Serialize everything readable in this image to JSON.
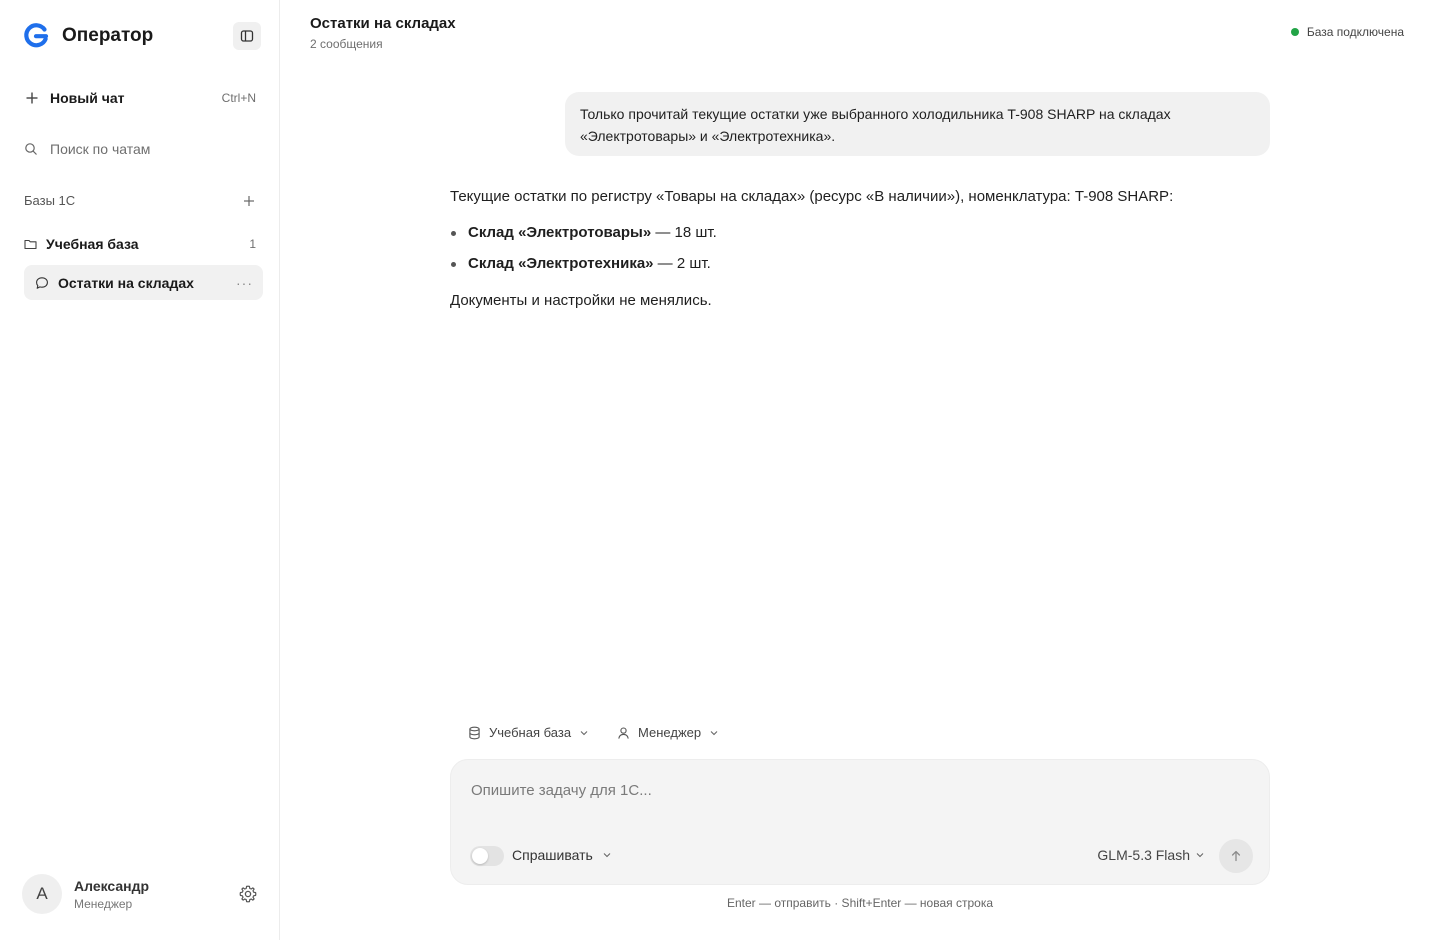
{
  "app": {
    "name": "Оператор"
  },
  "sidebar": {
    "new_chat_label": "Новый чат",
    "new_chat_shortcut": "Ctrl+N",
    "search_placeholder": "Поиск по чатам",
    "section_title": "Базы 1С",
    "folders": [
      {
        "label": "Учебная база",
        "count": "1"
      }
    ],
    "chats": [
      {
        "label": "Остатки на складах",
        "active": true
      }
    ],
    "user": {
      "initial": "A",
      "name": "Александр",
      "role": "Менеджер"
    }
  },
  "header": {
    "title": "Остатки на складах",
    "subtitle": "2 сообщения",
    "status_label": "База подключена",
    "status_color": "#22a447"
  },
  "messages": {
    "user": "Только прочитай текущие остатки уже выбранного холодильника T-908 SHARP на складах «Электротовары» и «Электротехника».",
    "assistant": {
      "intro": "Текущие остатки по регистру «Товары на складах» (ресурс «В наличии»), номенклатура: T-908 SHARP:",
      "items": [
        {
          "bold": "Склад «Электротовары»",
          "rest": " — 18 шт."
        },
        {
          "bold": "Склад «Электротехника»",
          "rest": " — 2 шт."
        }
      ],
      "closing": "Документы и настройки не менялись."
    }
  },
  "composer": {
    "database_selector": "Учебная база",
    "role_selector": "Менеджер",
    "placeholder": "Опишите задачу для 1С...",
    "mode_label": "Спрашивать",
    "mode_enabled": false,
    "model_label": "GLM-5.3 Flash",
    "hint": "Enter — отправить · Shift+Enter — новая строка"
  }
}
